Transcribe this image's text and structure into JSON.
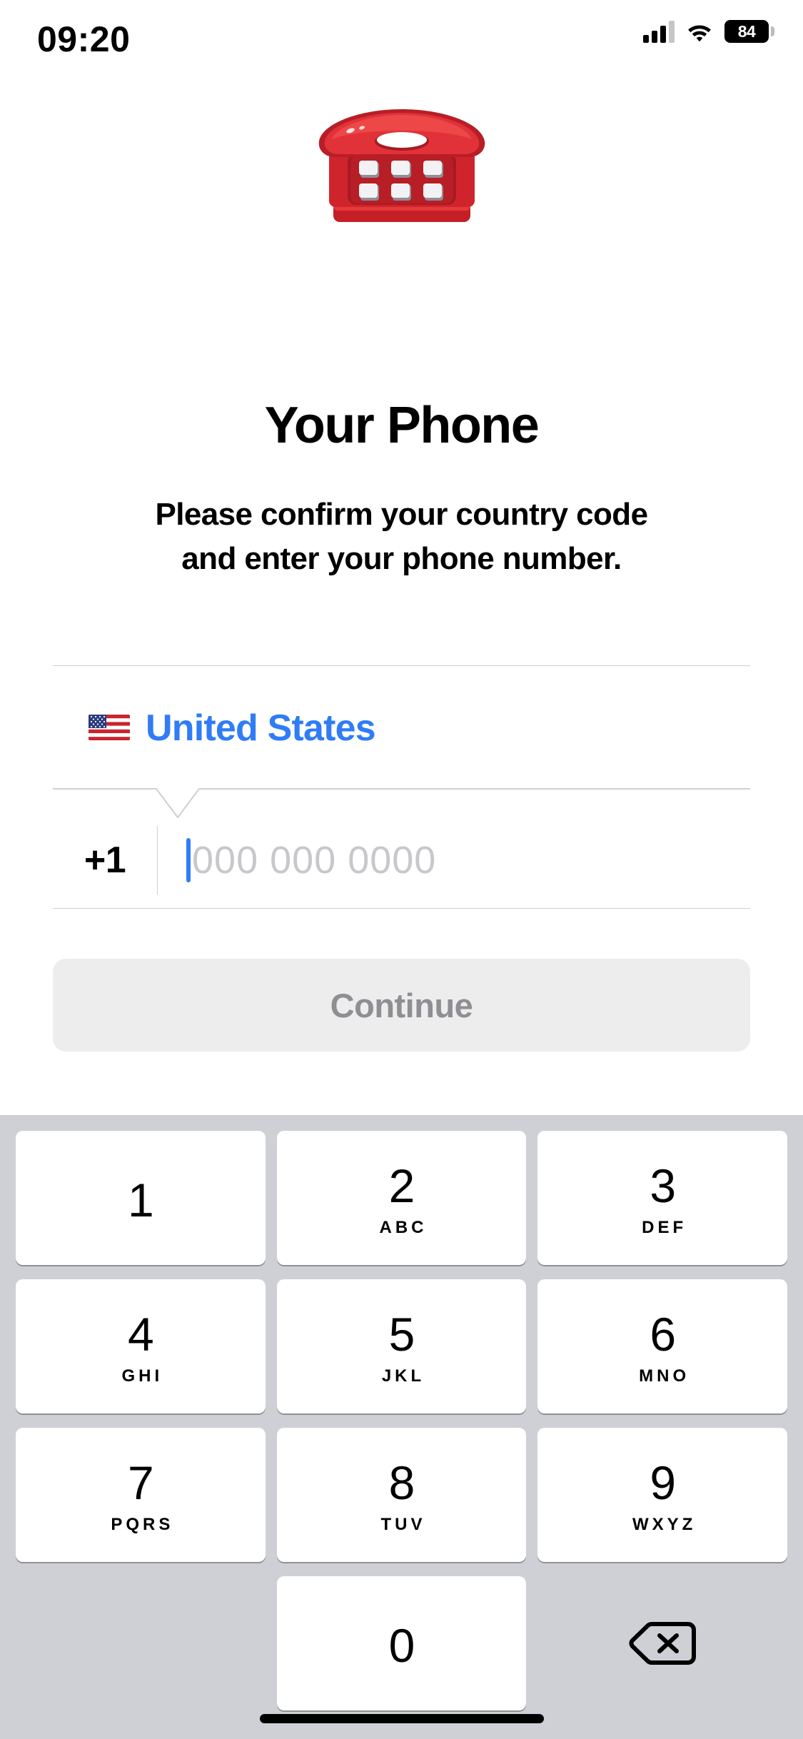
{
  "status_bar": {
    "time": "09:20",
    "battery_percent": "84",
    "signal_icon": "cellular-bars-icon",
    "wifi_icon": "wifi-icon",
    "battery_icon": "battery-icon"
  },
  "hero": {
    "icon": "telephone-emoji",
    "emoji": "☎️"
  },
  "header": {
    "title": "Your Phone",
    "subtitle_line1": "Please confirm your country code",
    "subtitle_line2": "and enter your phone number."
  },
  "form": {
    "country": {
      "flag_icon": "us-flag-emoji",
      "name": "United States"
    },
    "country_code": "+1",
    "phone_placeholder": "000 000 0000",
    "phone_value": ""
  },
  "actions": {
    "continue_label": "Continue",
    "continue_enabled": false
  },
  "keypad": {
    "rows": [
      [
        {
          "digit": "1",
          "letters": ""
        },
        {
          "digit": "2",
          "letters": "ABC"
        },
        {
          "digit": "3",
          "letters": "DEF"
        }
      ],
      [
        {
          "digit": "4",
          "letters": "GHI"
        },
        {
          "digit": "5",
          "letters": "JKL"
        },
        {
          "digit": "6",
          "letters": "MNO"
        }
      ],
      [
        {
          "digit": "7",
          "letters": "PQRS"
        },
        {
          "digit": "8",
          "letters": "TUV"
        },
        {
          "digit": "9",
          "letters": "WXYZ"
        }
      ],
      [
        {
          "digit": "",
          "letters": ""
        },
        {
          "digit": "0",
          "letters": ""
        },
        {
          "digit": "delete",
          "letters": ""
        }
      ]
    ],
    "delete_icon": "backspace-delete-icon"
  },
  "colors": {
    "accent_blue": "#2f7cf6",
    "placeholder_gray": "#c7c7cc",
    "keypad_background": "#ced0d6",
    "button_disabled_bg": "#ededed",
    "button_disabled_text": "#8e8e93",
    "divider": "#cfcfd2"
  },
  "home_indicator": "home-indicator"
}
